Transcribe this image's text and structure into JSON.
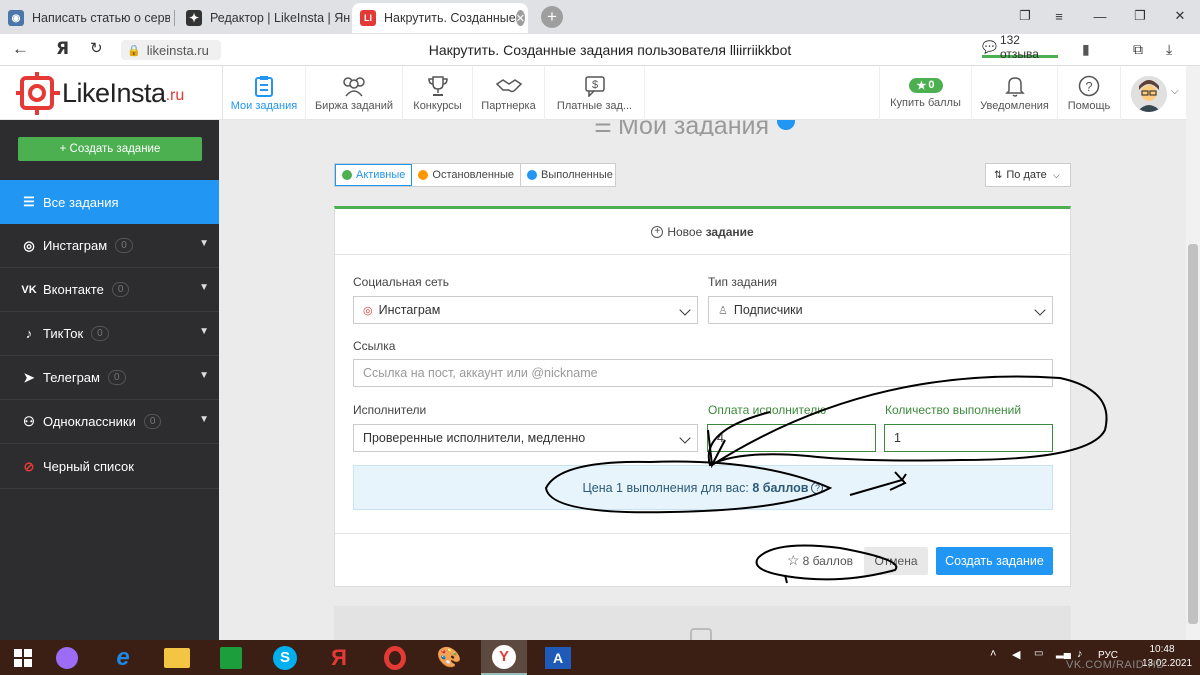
{
  "browser": {
    "tabs": [
      {
        "title": "Написать статью о сервис",
        "active": false
      },
      {
        "title": "Редактор | LikeInsta | Янде",
        "active": false
      },
      {
        "title": "Накрутить. Созданные",
        "active": true
      }
    ],
    "page_title": "Накрутить. Созданные задания пользователя lliirriikkbot",
    "url": "likeinsta.ru",
    "reviews": "132 отзыва"
  },
  "header": {
    "logo": "LikeInsta",
    "logo_suffix": ".ru",
    "nav": [
      {
        "label": "Мои задания",
        "active": true
      },
      {
        "label": "Биржа заданий"
      },
      {
        "label": "Конкурсы"
      },
      {
        "label": "Партнерка"
      },
      {
        "label": "Платные зад..."
      }
    ],
    "balance": "0",
    "buy_points": "Купить баллы",
    "notifications": "Уведомления",
    "help": "Помощь"
  },
  "sidebar": {
    "create_button": "+ Создать задание",
    "items": [
      {
        "label": "Все задания",
        "active": true
      },
      {
        "label": "Инстаграм",
        "count": "0"
      },
      {
        "label": "Вконтакте",
        "count": "0"
      },
      {
        "label": "ТикТок",
        "count": "0"
      },
      {
        "label": "Телеграм",
        "count": "0"
      },
      {
        "label": "Одноклассники",
        "count": "0"
      },
      {
        "label": "Черный список"
      }
    ]
  },
  "main": {
    "heading": "Мои задания",
    "filters": [
      "Активные",
      "Остановленные",
      "Выполненные"
    ],
    "sort": "По дате",
    "new_task_prefix": "Новое",
    "new_task_bold": "задание",
    "form": {
      "network_label": "Социальная сеть",
      "network_value": "Инстаграм",
      "type_label": "Тип задания",
      "type_value": "Подписчики",
      "link_label": "Ссылка",
      "link_placeholder": "Ссылка на пост, аккаунт или @nickname",
      "performers_label": "Исполнители",
      "performers_value": "Проверенные исполнители, медленно",
      "pay_label": "Оплата исполнителю",
      "pay_value": "4",
      "count_label": "Количество выполнений",
      "count_value": "1",
      "price_text": "Цена 1 выполнения для вас:",
      "price_value": "8 баллов"
    },
    "footer": {
      "total": "8 баллов",
      "cancel": "Отмена",
      "create": "Создать задание"
    }
  },
  "taskbar": {
    "lang": "РУС",
    "time": "10:48",
    "date": "13.02.2021",
    "watermark": "VK.COM/RAID HD"
  },
  "colors": {
    "accent_blue": "#2196f3",
    "green": "#4caf50",
    "sidebar": "#2d2d30"
  }
}
